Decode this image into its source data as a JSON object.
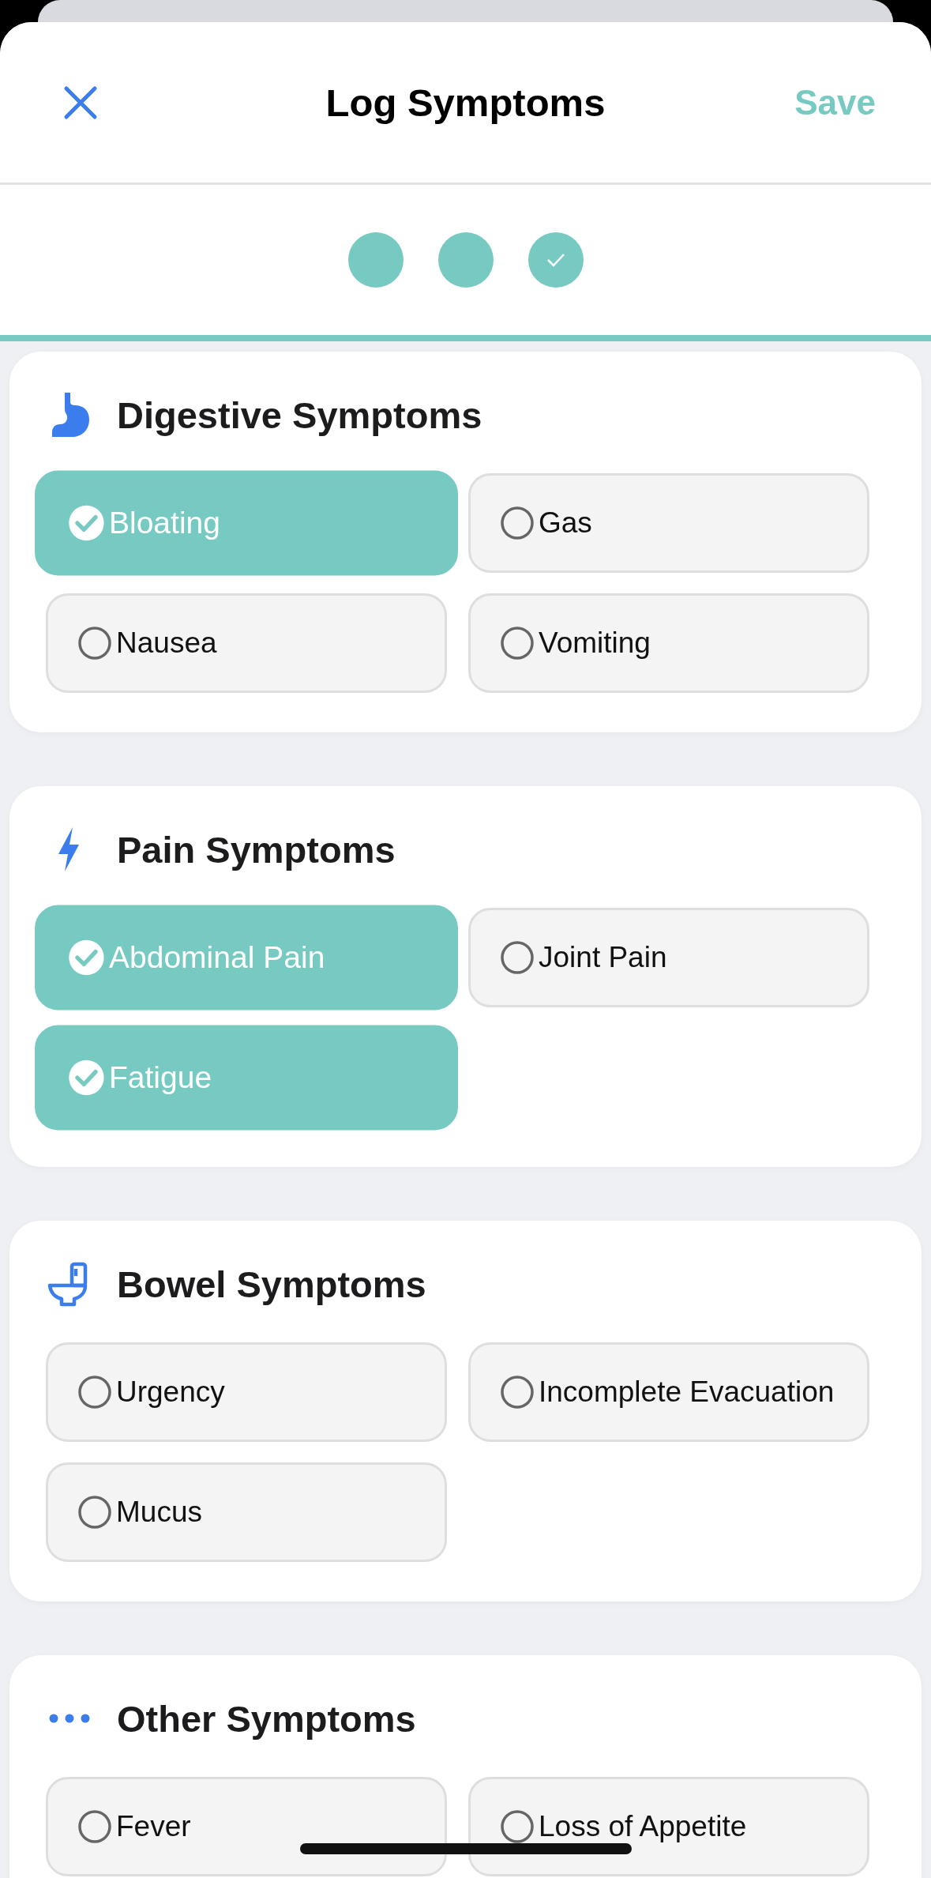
{
  "header": {
    "title": "Log Symptoms",
    "save": "Save"
  },
  "steps": [
    {
      "checked": false
    },
    {
      "checked": false
    },
    {
      "checked": true
    }
  ],
  "progress": {
    "level": 1
  },
  "sections": [
    {
      "kind": "digestive",
      "title": "Digestive Symptoms",
      "symptoms": [
        {
          "label": "Bloating",
          "selected": true
        },
        {
          "label": "Gas",
          "selected": false
        },
        {
          "label": "Nausea",
          "selected": false
        },
        {
          "label": "Vomiting",
          "selected": false
        }
      ]
    },
    {
      "kind": "pain",
      "title": "Pain Symptoms",
      "symptoms": [
        {
          "label": "Abdominal Pain",
          "selected": true
        },
        {
          "label": "Joint Pain",
          "selected": false
        },
        {
          "label": "Fatigue",
          "selected": true
        }
      ]
    },
    {
      "kind": "bowel",
      "title": "Bowel Symptoms",
      "symptoms": [
        {
          "label": "Urgency",
          "selected": false
        },
        {
          "label": "Incomplete Evacuation",
          "selected": false
        },
        {
          "label": "Mucus",
          "selected": false
        }
      ]
    },
    {
      "kind": "other",
      "title": "Other Symptoms",
      "symptoms": [
        {
          "label": "Fever",
          "selected": false
        },
        {
          "label": "Loss of Appetite",
          "selected": false
        }
      ]
    }
  ]
}
